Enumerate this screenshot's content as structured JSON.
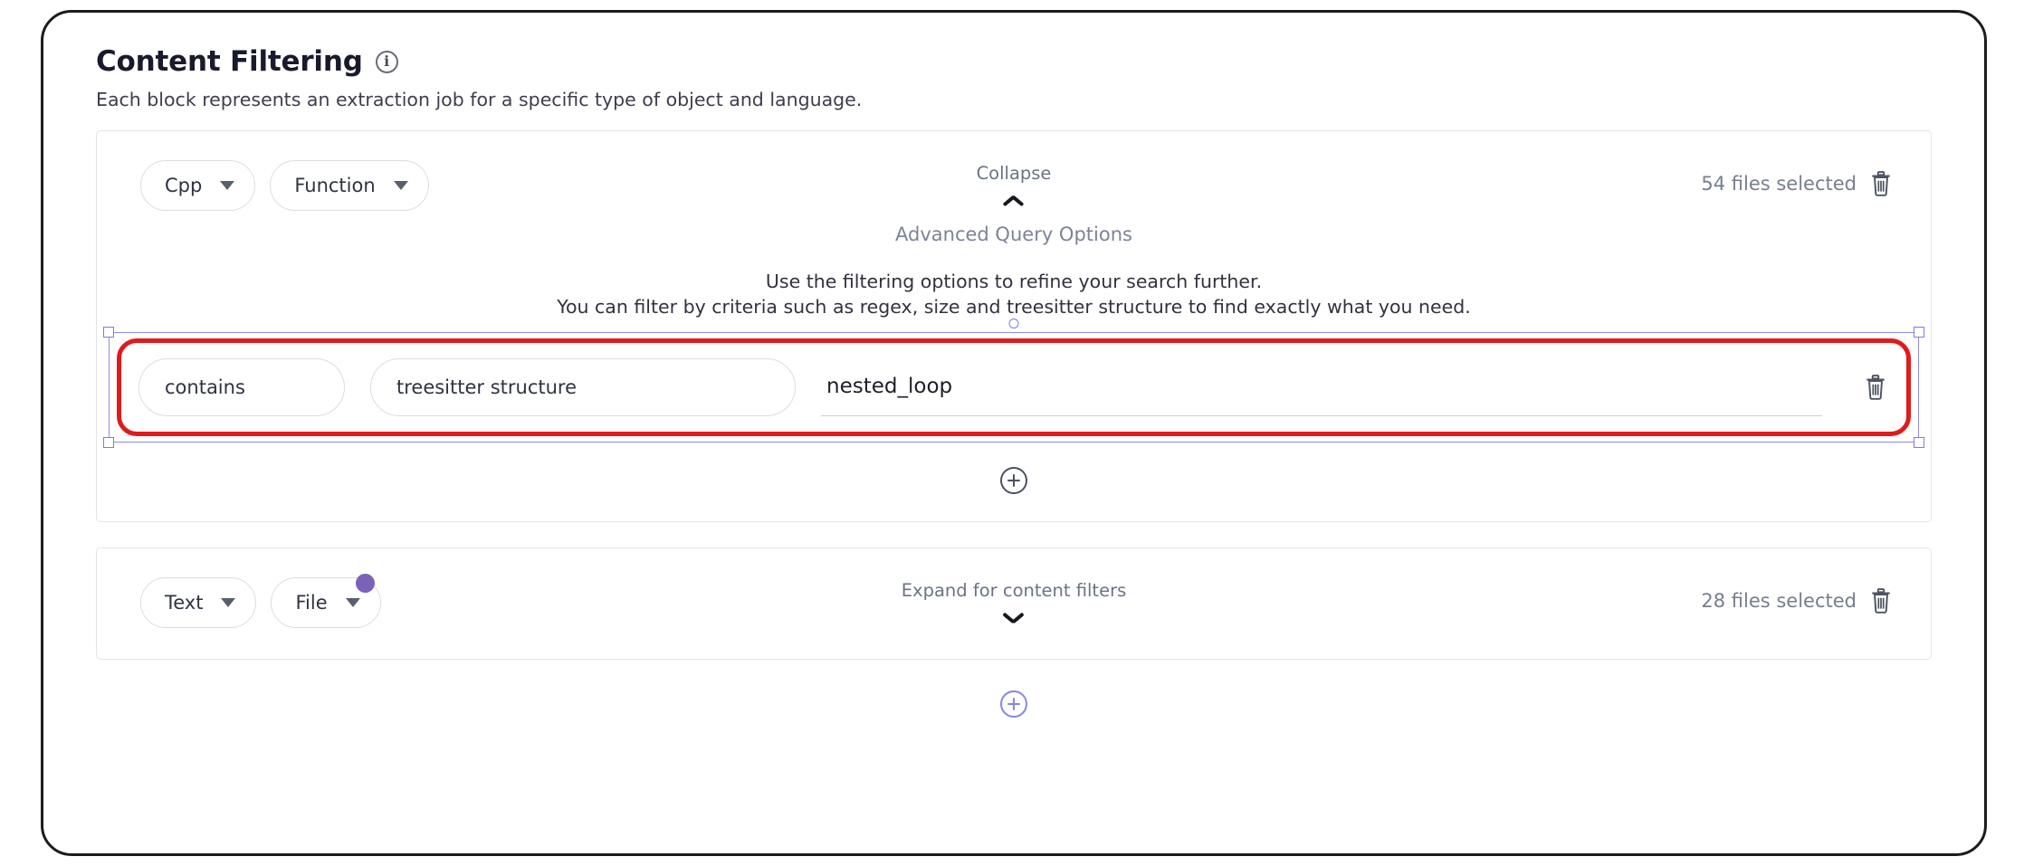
{
  "header": {
    "title": "Content Filtering",
    "info_icon": "info-icon",
    "subtitle": "Each block represents an extraction job for a specific type of object and language."
  },
  "colors": {
    "accent_purple": "#7a62b8",
    "selection_purple": "#8585ea",
    "highlight_red": "#e01b1b",
    "muted_text": "#767e8f",
    "body_text": "#32323f"
  },
  "blocks": [
    {
      "language_pill": {
        "label": "Cpp",
        "caret": "chevron-down-icon"
      },
      "object_pill": {
        "label": "Function",
        "caret": "chevron-down-icon",
        "has_badge": false
      },
      "toggle": {
        "label": "Collapse",
        "chevron": "chevron-up-icon"
      },
      "files": {
        "count_label": "54 files selected",
        "delete_icon": "trash-icon"
      },
      "advanced": {
        "title": "Advanced Query Options",
        "line1": "Use the filtering options to refine your search further.",
        "line2": "You can filter by criteria such as regex, size and treesitter structure to find exactly what you need."
      },
      "filter_rows": [
        {
          "operator": {
            "value": "contains",
            "caret": "chevron-down-icon"
          },
          "field": {
            "value": "treesitter structure",
            "caret": "chevron-down-icon"
          },
          "value_field": {
            "value": "nested_loop",
            "placeholder": "",
            "caret": "chevron-down-icon"
          },
          "delete_icon": "trash-icon",
          "selected": true
        }
      ],
      "add_filter": {
        "icon": "plus-circle-icon"
      }
    },
    {
      "language_pill": {
        "label": "Text",
        "caret": "chevron-down-icon"
      },
      "object_pill": {
        "label": "File",
        "caret": "chevron-down-icon",
        "has_badge": true
      },
      "toggle": {
        "label": "Expand for content filters",
        "chevron": "chevron-down-icon"
      },
      "files": {
        "count_label": "28 files selected",
        "delete_icon": "trash-icon"
      }
    }
  ],
  "add_block": {
    "icon": "plus-circle-icon"
  }
}
